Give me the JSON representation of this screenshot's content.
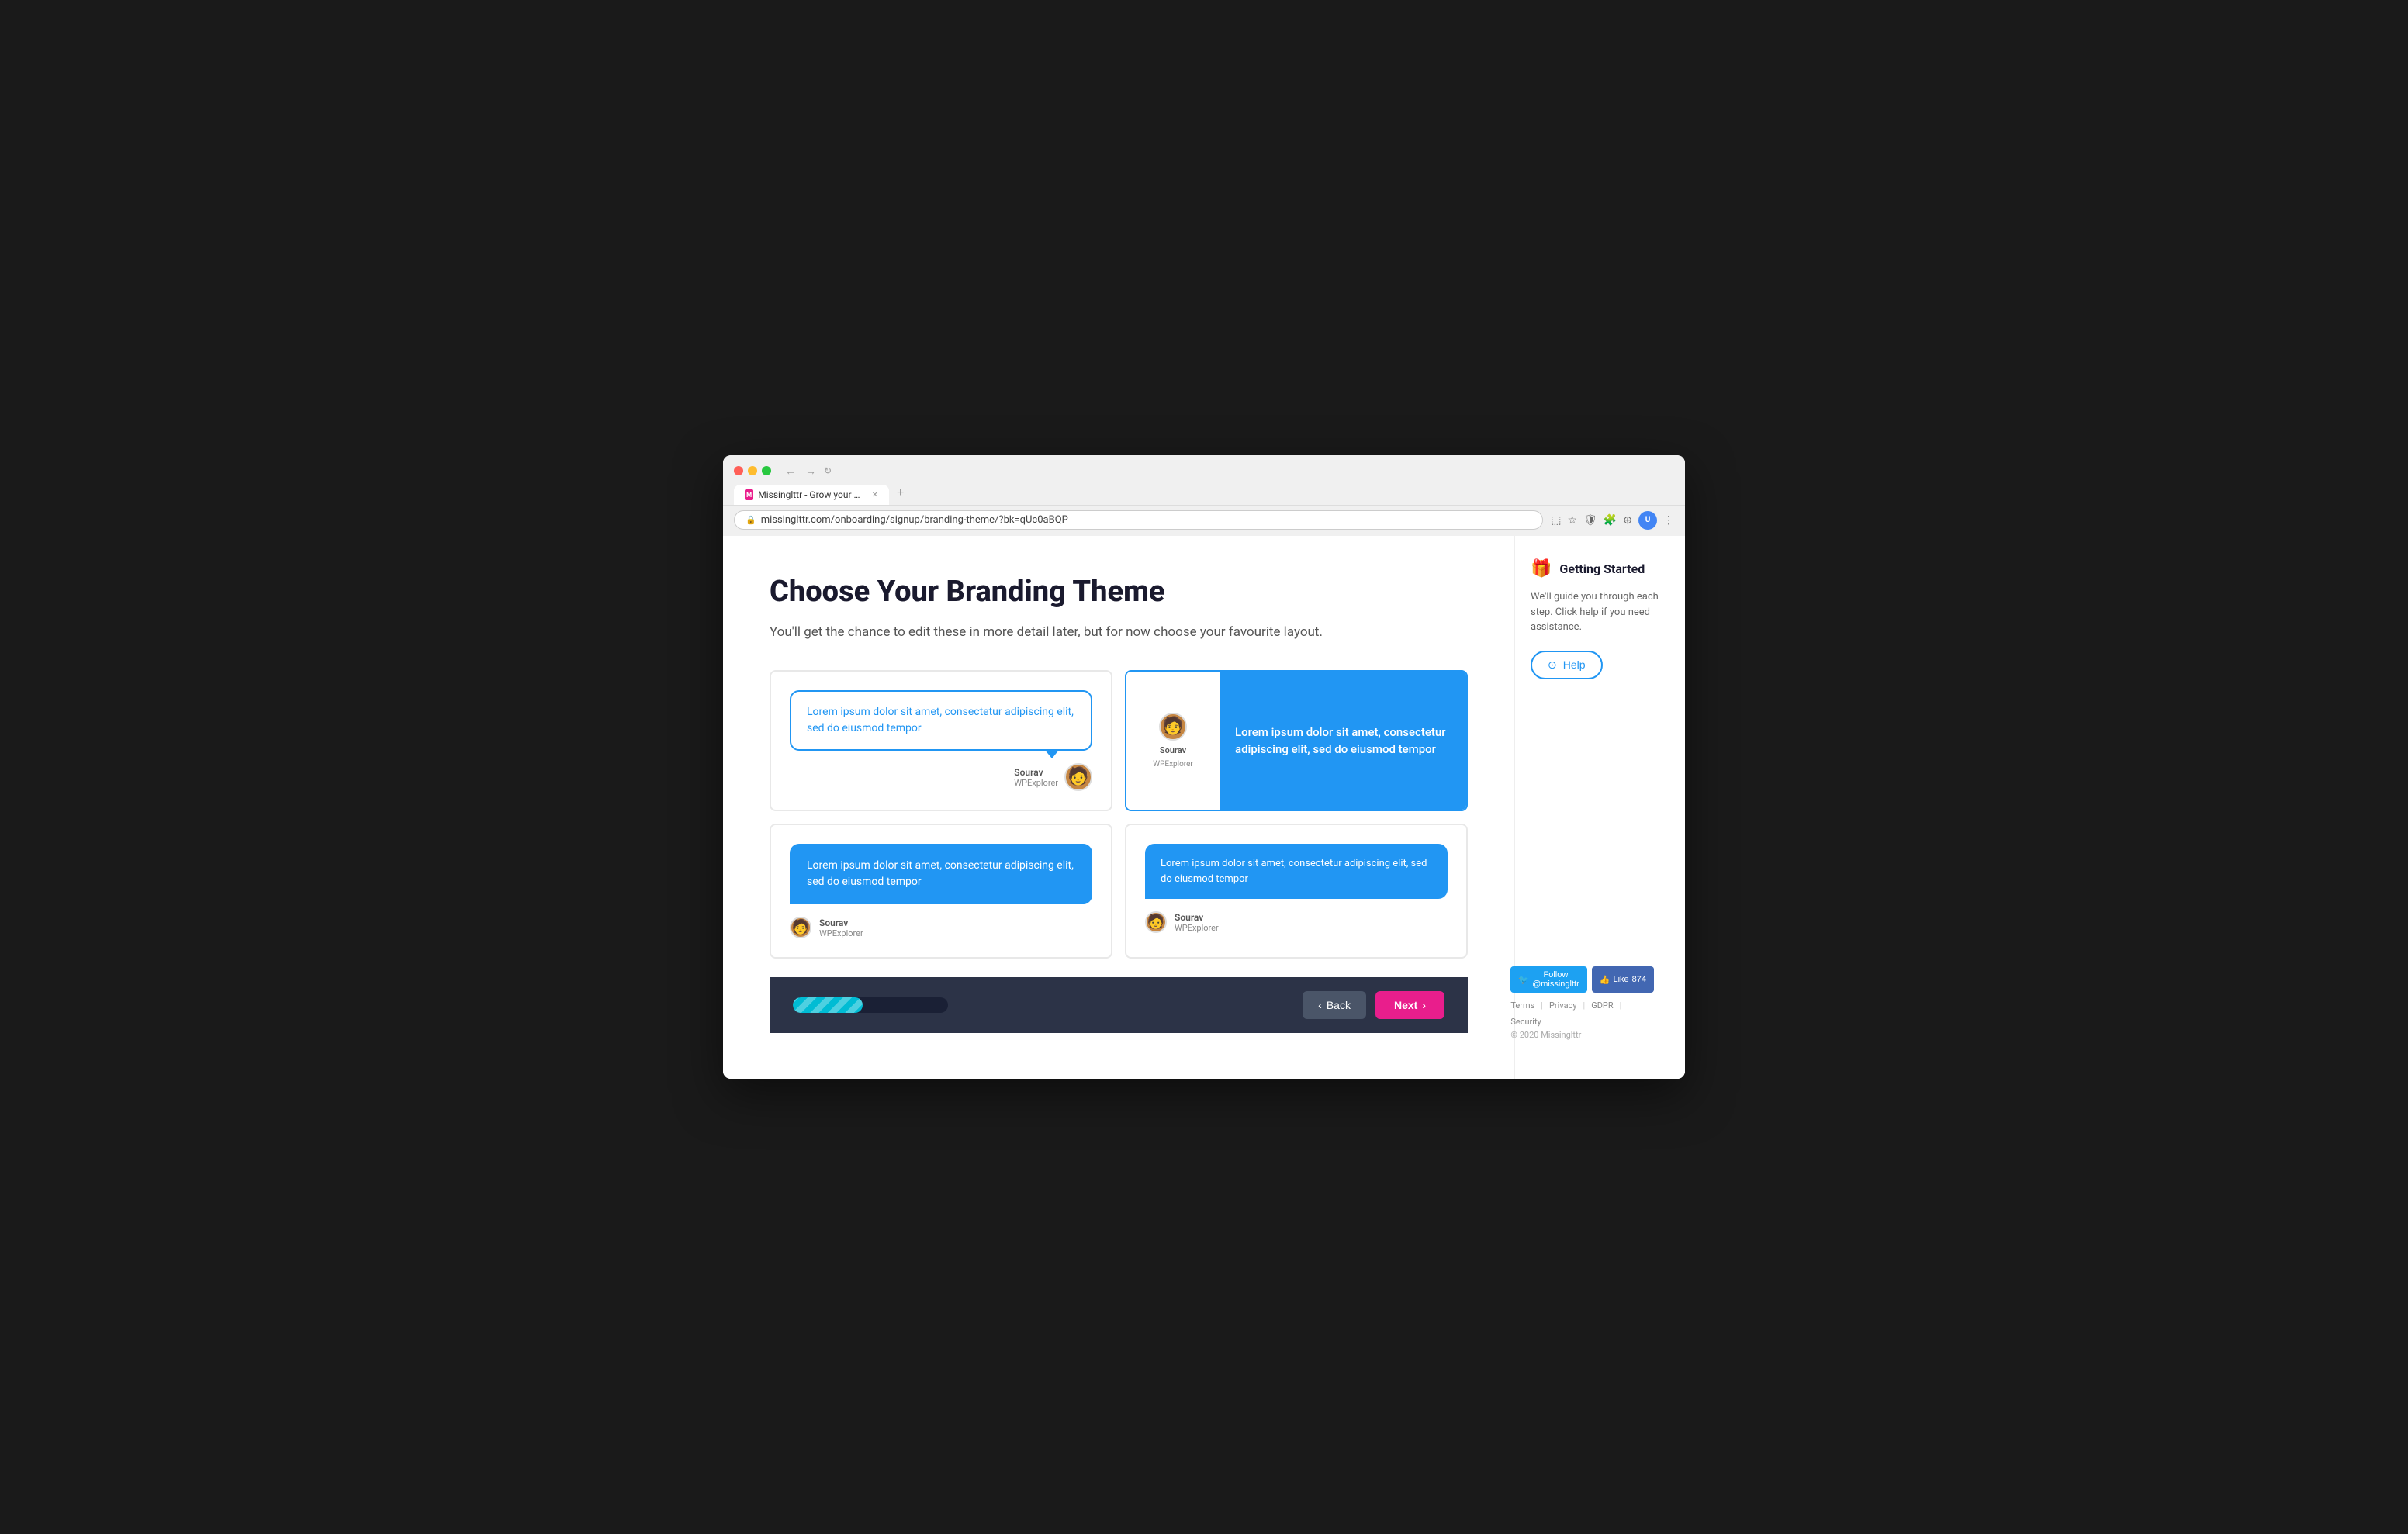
{
  "browser": {
    "tab_title": "Missinglttr - Grow your blog th...",
    "url": "missinglttr.com/onboarding/signup/branding-theme/?bk=qUc0aBQP",
    "new_tab_label": "+"
  },
  "page": {
    "title": "Choose Your Branding Theme",
    "subtitle": "You'll get the chance to edit these in more detail later, but for now choose your favourite layout.",
    "lorem_text_1": "Lorem ipsum dolor sit amet, consectetur adipiscing elit, sed do eiusmod tempor",
    "lorem_text_2": "Lorem ipsum dolor sit amet, consectetur adipiscing elit, sed do eiusmod tempor",
    "lorem_text_3": "Lorem ipsum dolor sit amet, consectetur adipiscing elit, sed do eiusmod tempor",
    "lorem_text_4": "Lorem ipsum dolor sit amet, consectetur adipiscing elit, sed do eiusmod tempor",
    "author_name": "Sourav",
    "author_site": "WPExplorer"
  },
  "sidebar": {
    "getting_started_title": "Getting Started",
    "getting_started_desc": "We'll guide you through each step. Click help if you need assistance.",
    "help_button_label": "Help"
  },
  "bottom_bar": {
    "back_label": "Back",
    "next_label": "Next"
  },
  "footer": {
    "follow_label": "Follow @missinglttr",
    "like_label": "Like",
    "like_count": "874",
    "terms": "Terms",
    "privacy": "Privacy",
    "gdpr": "GDPR",
    "security": "Security",
    "copyright": "© 2020 Missinglttr"
  }
}
